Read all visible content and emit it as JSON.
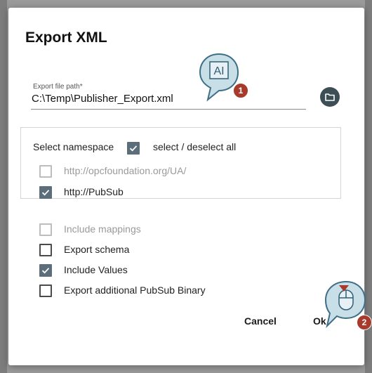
{
  "dialog": {
    "title": "Export XML",
    "file_path": {
      "label": "Export file path*",
      "value": "C:\\Temp\\Publisher_Export.xml",
      "browse_icon": "folder-icon"
    },
    "namespace": {
      "header_label": "Select namespace",
      "select_all_label": "select / deselect all",
      "select_all_checked": true,
      "items": [
        {
          "label": "http://opcfoundation.org/UA/",
          "checked": false,
          "disabled": true
        },
        {
          "label": "http://PubSub",
          "checked": true,
          "disabled": false
        }
      ]
    },
    "options": [
      {
        "label": "Include mappings",
        "checked": false,
        "disabled": true
      },
      {
        "label": "Export schema",
        "checked": false,
        "disabled": false
      },
      {
        "label": "Include Values",
        "checked": true,
        "disabled": false
      },
      {
        "label": "Export additional PubSub Binary",
        "checked": false,
        "disabled": false
      }
    ],
    "buttons": {
      "cancel_label": "Cancel",
      "ok_label": "Ok"
    }
  },
  "annotations": {
    "callout1": {
      "number": "1",
      "icon": "text-input-icon",
      "glyph": "AI"
    },
    "callout2": {
      "number": "2",
      "icon": "mouse-click-icon"
    }
  },
  "colors": {
    "accent": "#5b6e7a",
    "icon_button": "#3d4e57",
    "callout_fill": "#c9dfe8",
    "callout_stroke": "#3f6f86",
    "badge": "#a83a2c"
  }
}
